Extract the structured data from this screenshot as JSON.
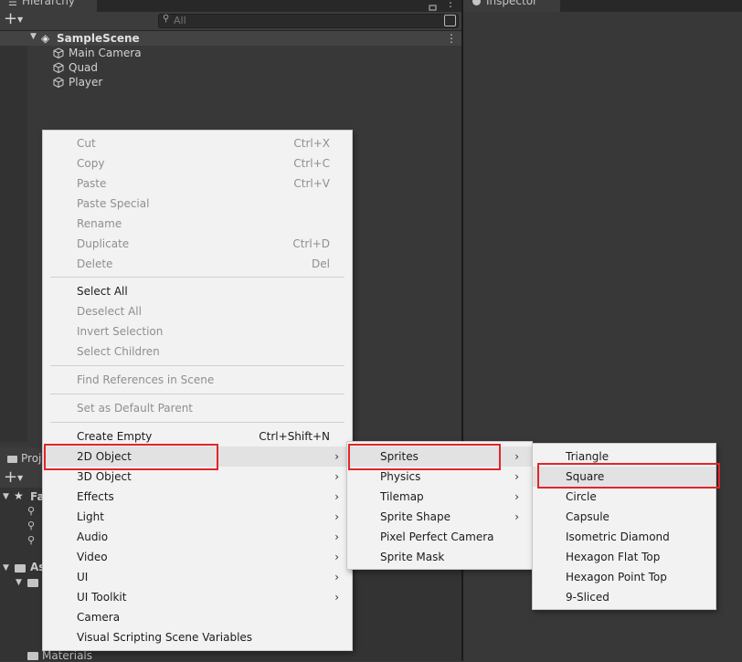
{
  "hierarchy": {
    "tab_label": "Hierarchy",
    "search_placeholder": "All",
    "scene_name": "SampleScene",
    "items": [
      "Main Camera",
      "Quad",
      "Player"
    ]
  },
  "inspector": {
    "tab_label": "Inspector"
  },
  "project": {
    "tab_label": "Proj",
    "favorites_label": "Fa",
    "assets_label": "As",
    "materials_label": "Materials"
  },
  "context_menu": {
    "items": [
      {
        "label": "Cut",
        "shortcut": "Ctrl+X"
      },
      {
        "label": "Copy",
        "shortcut": "Ctrl+C"
      },
      {
        "label": "Paste",
        "shortcut": "Ctrl+V"
      },
      {
        "label": "Paste Special",
        "shortcut": ""
      },
      {
        "label": "Rename",
        "shortcut": ""
      },
      {
        "label": "Duplicate",
        "shortcut": "Ctrl+D"
      },
      {
        "label": "Delete",
        "shortcut": "Del"
      },
      {
        "label": "Select All",
        "shortcut": ""
      },
      {
        "label": "Deselect All",
        "shortcut": ""
      },
      {
        "label": "Invert Selection",
        "shortcut": ""
      },
      {
        "label": "Select Children",
        "shortcut": ""
      },
      {
        "label": "Find References in Scene",
        "shortcut": ""
      },
      {
        "label": "Set as Default Parent",
        "shortcut": ""
      },
      {
        "label": "Create Empty",
        "shortcut": "Ctrl+Shift+N"
      },
      {
        "label": "2D Object",
        "shortcut": ""
      },
      {
        "label": "3D Object",
        "shortcut": ""
      },
      {
        "label": "Effects",
        "shortcut": ""
      },
      {
        "label": "Light",
        "shortcut": ""
      },
      {
        "label": "Audio",
        "shortcut": ""
      },
      {
        "label": "Video",
        "shortcut": ""
      },
      {
        "label": "UI",
        "shortcut": ""
      },
      {
        "label": "UI Toolkit",
        "shortcut": ""
      },
      {
        "label": "Camera",
        "shortcut": ""
      },
      {
        "label": "Visual Scripting Scene Variables",
        "shortcut": ""
      }
    ]
  },
  "submenu_2d": {
    "items": [
      "Sprites",
      "Physics",
      "Tilemap",
      "Sprite Shape",
      "Pixel Perfect Camera",
      "Sprite Mask"
    ]
  },
  "submenu_sprites": {
    "items": [
      "Triangle",
      "Square",
      "Circle",
      "Capsule",
      "Isometric Diamond",
      "Hexagon Flat Top",
      "Hexagon Point Top",
      "9-Sliced"
    ]
  },
  "icons": {
    "plus": "plus-icon",
    "dropdown": "chevron-down-icon",
    "search": "search-icon",
    "lock": "lock-icon",
    "kebab": "more-vertical-icon",
    "unity": "unity-logo-icon",
    "gameobject": "cube-icon",
    "submenu_arrow": "chevron-right-icon",
    "info": "info-icon",
    "folder": "folder-icon",
    "star": "star-icon"
  },
  "colors": {
    "highlight_box": "#e0262b",
    "menu_bg": "#f2f2f2",
    "editor_bg": "#383838"
  }
}
